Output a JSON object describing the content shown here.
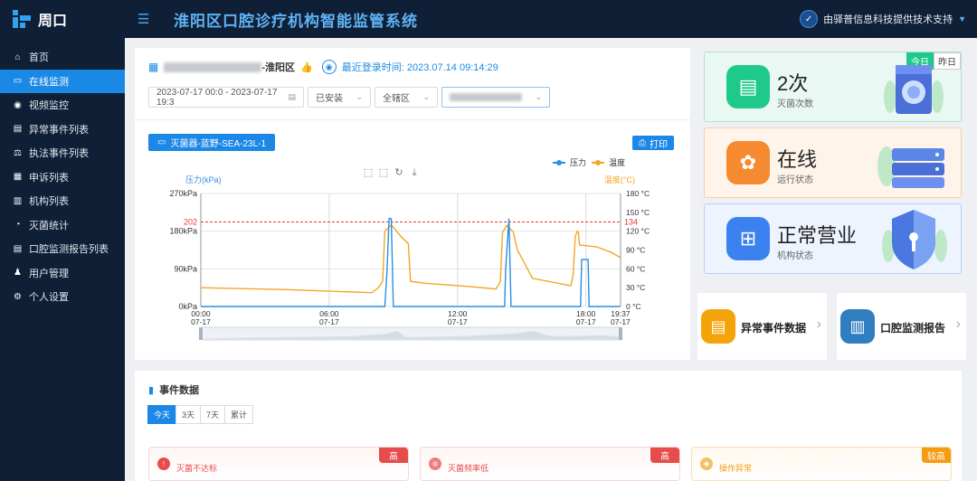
{
  "app": {
    "name": "周口",
    "title": "淮阳区口腔诊疗机构智能监管系统",
    "support": "由驿普信息科技提供技术支持"
  },
  "sidebar": {
    "items": [
      {
        "label": "首页",
        "icon": "home-icon",
        "active": false
      },
      {
        "label": "在线监测",
        "icon": "monitor-icon",
        "active": true
      },
      {
        "label": "视频监控",
        "icon": "camera-icon",
        "active": false
      },
      {
        "label": "异常事件列表",
        "icon": "list-icon",
        "active": false
      },
      {
        "label": "执法事件列表",
        "icon": "law-icon",
        "active": false
      },
      {
        "label": "申诉列表",
        "icon": "appeal-icon",
        "active": false
      },
      {
        "label": "机构列表",
        "icon": "building-icon",
        "active": false
      },
      {
        "label": "灭菌统计",
        "icon": "pie-chart-icon",
        "active": false
      },
      {
        "label": "口腔监测报告列表",
        "icon": "report-icon",
        "active": false
      },
      {
        "label": "用户管理",
        "icon": "users-icon",
        "active": false
      },
      {
        "label": "个人设置",
        "icon": "gear-icon",
        "active": false
      }
    ]
  },
  "header_info": {
    "district_suffix": "-淮阳区",
    "login_label": "最近登录时间:",
    "login_time": "2023.07.14 09:14:29"
  },
  "filters": {
    "date_range": "2023-07-17 00:0 - 2023-07-17 19:3",
    "install_status": "已安装",
    "region": "全辖区"
  },
  "device": {
    "tag": "灭菌器-蓝野-SEA-23L-1",
    "print_label": "打印"
  },
  "chart_data": {
    "type": "line",
    "legend": [
      "压力",
      "温度"
    ],
    "left_axis": {
      "label": "压力(kPa)",
      "ticks": [
        "270kPa",
        "180kPa",
        "90kPa",
        "0kPa"
      ],
      "range": [
        0,
        270
      ]
    },
    "right_axis": {
      "label": "温度(°C)",
      "ticks": [
        "180 °C",
        "150 °C",
        "120 °C",
        "90 °C",
        "60 °C",
        "30 °C",
        "0 °C"
      ],
      "range": [
        0,
        180
      ]
    },
    "threshold": {
      "pressure": 202,
      "temperature": 134
    },
    "x_ticks": [
      {
        "t": "00:00",
        "d": "07-17"
      },
      {
        "t": "06:00",
        "d": "07-17"
      },
      {
        "t": "12:00",
        "d": "07-17"
      },
      {
        "t": "18:00",
        "d": "07-17"
      },
      {
        "t": "19:37",
        "d": "07-17"
      }
    ],
    "x_range_hours": [
      0,
      19.62
    ],
    "series": [
      {
        "name": "温度",
        "color": "#f5a623",
        "points": [
          [
            0,
            30
          ],
          [
            4,
            27
          ],
          [
            8,
            22
          ],
          [
            8.3,
            30
          ],
          [
            8.5,
            40
          ],
          [
            8.6,
            120
          ],
          [
            8.9,
            130
          ],
          [
            9.1,
            122
          ],
          [
            9.4,
            110
          ],
          [
            9.7,
            100
          ],
          [
            9.8,
            40
          ],
          [
            10.5,
            37
          ],
          [
            12.5,
            32
          ],
          [
            13.8,
            28
          ],
          [
            14,
            40
          ],
          [
            14.1,
            118
          ],
          [
            14.3,
            129
          ],
          [
            14.6,
            119
          ],
          [
            14.8,
            90
          ],
          [
            15.5,
            45
          ],
          [
            17,
            35
          ],
          [
            17.3,
            33
          ],
          [
            17.4,
            50
          ],
          [
            17.5,
            112
          ],
          [
            17.6,
            120
          ],
          [
            17.65,
            118
          ],
          [
            17.7,
            98
          ],
          [
            18.5,
            95
          ],
          [
            19.2,
            86
          ],
          [
            19.6,
            78
          ]
        ]
      },
      {
        "name": "压力",
        "color": "#2a8fe0",
        "points": [
          [
            0,
            0
          ],
          [
            8.6,
            0
          ],
          [
            8.7,
            80
          ],
          [
            8.8,
            210
          ],
          [
            8.9,
            210
          ],
          [
            9.0,
            0
          ],
          [
            14.2,
            0
          ],
          [
            14.25,
            90
          ],
          [
            14.4,
            210
          ],
          [
            14.5,
            0
          ],
          [
            17.75,
            0
          ],
          [
            17.8,
            112
          ],
          [
            18.1,
            112
          ],
          [
            18.15,
            0
          ],
          [
            19.6,
            0
          ]
        ]
      }
    ]
  },
  "stats": [
    {
      "value": "2次",
      "label": "灭菌次数",
      "tab_today": "今日",
      "tab_yesterday": "昨日"
    },
    {
      "value": "在线",
      "label": "运行状态"
    },
    {
      "value": "正常营业",
      "label": "机构状态"
    }
  ],
  "quick_links": [
    {
      "label": "异常事件数据",
      "icon": "warning-doc-icon",
      "color": "#f5a30a"
    },
    {
      "label": "口腔监测报告",
      "icon": "document-icon",
      "color": "#2f7ec0"
    }
  ],
  "events": {
    "title": "事件数据",
    "tabs": [
      "今天",
      "3天",
      "7天",
      "累计"
    ],
    "alerts": [
      {
        "label": "灭菌不达标",
        "badge": "高",
        "color": "#e74c4c"
      },
      {
        "label": "灭菌频率低",
        "badge": "高",
        "color": "#e74c4c"
      },
      {
        "label": "操作异常",
        "badge": "较高",
        "color": "#f39c12"
      }
    ]
  }
}
